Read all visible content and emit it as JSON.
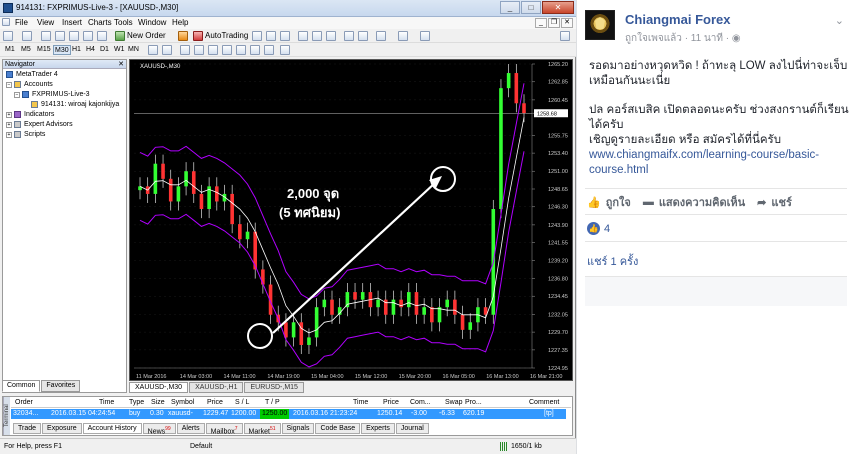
{
  "mt4": {
    "title": "914131: FXPRIMUS-Live-3 - [XAUUSD-,M30]",
    "menu": [
      "File",
      "View",
      "Insert",
      "Charts",
      "Tools",
      "Window",
      "Help"
    ],
    "toolbar": {
      "new_order": "New Order",
      "autotrading": "AutoTrading"
    },
    "timeframes": [
      "M1",
      "M5",
      "M15",
      "M30",
      "H1",
      "H4",
      "D1",
      "W1",
      "MN"
    ],
    "active_timeframe": "M30",
    "navigator": {
      "title": "Navigator",
      "items": [
        "MetaTrader 4",
        "Accounts",
        "FXPRIMUS-Live-3",
        "914131: wiroaj kajonkijya",
        "Indicators",
        "Expert Advisors",
        "Scripts"
      ],
      "tabs": [
        "Common",
        "Favorites"
      ]
    },
    "chart": {
      "symbol_label": "XAUUSD-,M30",
      "current_price": "1258.68",
      "annotation_line1": "2,000 จุด",
      "annotation_line2": "(5 ทศนิยม)"
    },
    "chart_tabs": [
      "XAUUSD-,M30",
      "XAUUSD-,H1",
      "EURUSD-,M15"
    ],
    "terminal": {
      "side_label": "Terminal",
      "headers": [
        "Order",
        "Time",
        "Type",
        "Size",
        "Symbol",
        "Price",
        "S / L",
        "T / P",
        "Time",
        "Price",
        "Com...",
        "Swap",
        "Pro...",
        "Comment"
      ],
      "row": [
        "32034...",
        "2016.03.15 04:24:54",
        "buy",
        "0.30",
        "xauusd-",
        "1229.47",
        "1200.00",
        "1250.00",
        "2016.03.16 21:23:24",
        "1250.14",
        "-3.00",
        "-6.33",
        "620.19",
        "[tp]"
      ],
      "tabs": [
        {
          "label": "Trade",
          "badge": ""
        },
        {
          "label": "Exposure",
          "badge": ""
        },
        {
          "label": "Account History",
          "badge": ""
        },
        {
          "label": "News",
          "badge": "99"
        },
        {
          "label": "Alerts",
          "badge": ""
        },
        {
          "label": "Mailbox",
          "badge": "7"
        },
        {
          "label": "Market",
          "badge": "51"
        },
        {
          "label": "Signals",
          "badge": ""
        },
        {
          "label": "Code Base",
          "badge": ""
        },
        {
          "label": "Experts",
          "badge": ""
        },
        {
          "label": "Journal",
          "badge": ""
        }
      ]
    },
    "status": {
      "help": "For Help, press F1",
      "profile": "Default",
      "traffic": "1650/1 kb"
    }
  },
  "fb": {
    "page_name": "Chiangmai Forex",
    "meta": "ถูกใจเพจแล้ว · 11 นาที · ",
    "body": [
      "รอดมาอย่างหวุดหวิด ! ถ้าทะลุ LOW ลงไปนี่ท่าจะเจ็บเหมือนกันนะเนี่ย",
      "ปล คอร์สเบสิค เปิดตลอดนะครับ ช่วงสงกรานต์ก็เรียนได้ครับ",
      "เชิญดูรายละเอียด หรือ สมัครได้ที่นี่ครับ"
    ],
    "link": "www.chiangmaifx.com/learning-course/basic-course.html",
    "actions": {
      "like": "ถูกใจ",
      "comment": "แสดงความคิดเห็น",
      "share": "แชร์"
    },
    "like_count": "4",
    "shares": "แชร์ 1 ครั้ง"
  },
  "chart_data": {
    "type": "line",
    "title": "XAUUSD-,M30",
    "ylim": [
      1224.95,
      1265.2
    ],
    "y_ticks": [
      "1265.20",
      "1262.85",
      "1260.45",
      "1258.68",
      "1255.75",
      "1253.40",
      "1251.00",
      "1248.65",
      "1246.30",
      "1243.90",
      "1241.55",
      "1239.20",
      "1236.80",
      "1234.45",
      "1232.05",
      "1229.70",
      "1227.35",
      "1224.95"
    ],
    "x_ticks": [
      "11 Mar 2016",
      "14 Mar 03:00",
      "14 Mar 11:00",
      "14 Mar 19:00",
      "15 Mar 04:00",
      "15 Mar 12:00",
      "15 Mar 20:00",
      "16 Mar 05:00",
      "16 Mar 13:00",
      "16 Mar 21:00"
    ],
    "series": [
      {
        "values": [
          1249,
          1248,
          1252,
          1250,
          1247,
          1249,
          1251,
          1248,
          1246,
          1249,
          1247,
          1248,
          1244,
          1242,
          1243,
          1238,
          1236,
          1232,
          1231,
          1229,
          1231,
          1228,
          1229,
          1233,
          1234,
          1232,
          1233,
          1235,
          1234,
          1235,
          1233,
          1234,
          1232,
          1234,
          1233,
          1235,
          1232,
          1233,
          1231,
          1233,
          1234,
          1232,
          1230,
          1231,
          1233,
          1232,
          1246,
          1262,
          1264,
          1260,
          1258.7
        ]
      }
    ]
  }
}
